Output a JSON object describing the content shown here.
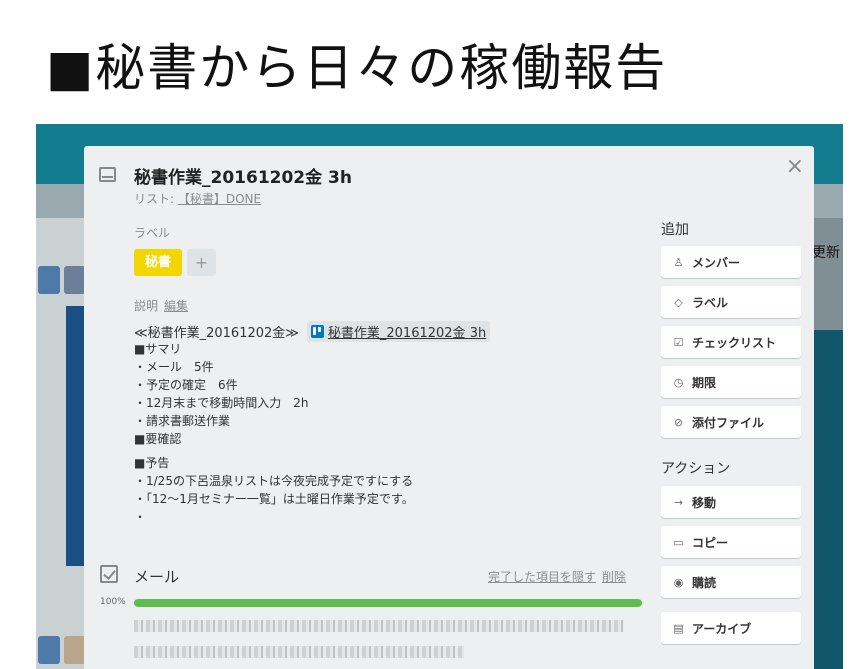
{
  "slide": {
    "title": "■秘書から日々の稼働報告"
  },
  "background": {
    "right_text": "更新"
  },
  "card": {
    "title": "秘書作業_20161202金 3h",
    "list_prefix": "リスト: ",
    "list_name": "【秘書】DONE",
    "label_heading": "ラベル",
    "label": {
      "text": "秘書",
      "color": "#f2d600"
    },
    "label_add": "+",
    "description_heading": "説明",
    "description_edit": "編集",
    "description_intro": "≪秘書作業_20161202金≫",
    "description_link": "秘書作業_20161202金 3h",
    "description_lines_a": [
      "■サマリ",
      "・メール　5件",
      "・予定の確定　6件",
      "・12月末まで移動時間入力　2h",
      "・請求書郵送作業",
      "■要確認"
    ],
    "description_lines_b": [
      "■予告",
      "・1/25の下呂温泉リストは今夜完成予定ですにする",
      "・「12～1月セミナー一覧」は土曜日作業予定です。",
      "・"
    ],
    "close_icon": "×"
  },
  "checklist": {
    "title": "メール",
    "hide_completed": "完了した項目を隠す",
    "delete": "削除",
    "progress_label": "100%",
    "progress": 1.0,
    "bar_color": "#61bd4f"
  },
  "sidebar": {
    "add_heading": "追加",
    "add_buttons": [
      {
        "icon": "person-icon",
        "glyph": "♙",
        "label": "メンバー"
      },
      {
        "icon": "tag-icon",
        "glyph": "◇",
        "label": "ラベル"
      },
      {
        "icon": "checklist-icon",
        "glyph": "☑",
        "label": "チェックリスト"
      },
      {
        "icon": "clock-icon",
        "glyph": "◷",
        "label": "期限"
      },
      {
        "icon": "paperclip-icon",
        "glyph": "⊘",
        "label": "添付ファイル"
      }
    ],
    "actions_heading": "アクション",
    "action_buttons": [
      {
        "icon": "arrow-right-icon",
        "glyph": "→",
        "label": "移動"
      },
      {
        "icon": "copy-icon",
        "glyph": "▭",
        "label": "コピー"
      },
      {
        "icon": "eye-icon",
        "glyph": "◉",
        "label": "購読"
      },
      {
        "icon": "archive-icon",
        "glyph": "▤",
        "label": "アーカイブ"
      }
    ]
  }
}
